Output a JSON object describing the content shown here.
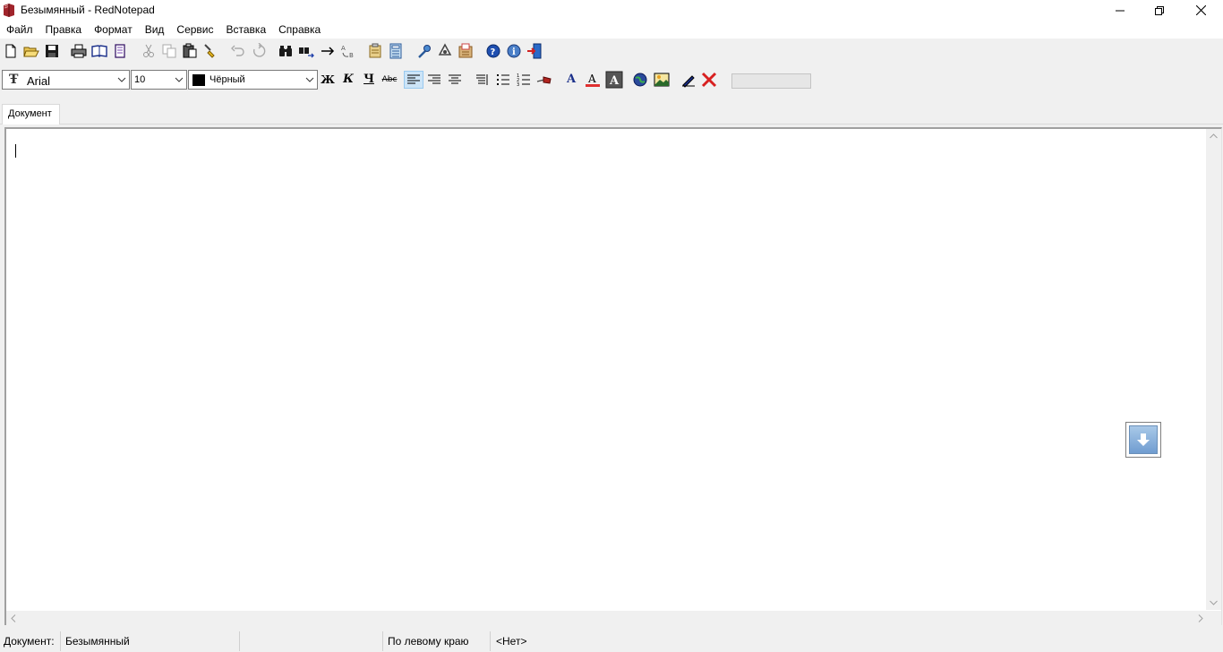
{
  "window": {
    "title": "Безымянный - RedNotepad"
  },
  "menu": [
    "Файл",
    "Правка",
    "Формат",
    "Вид",
    "Сервис",
    "Вставка",
    "Справка"
  ],
  "format_bar": {
    "font": "Arial",
    "font_icon_glyph": "Ŧ",
    "size": "10",
    "color_name": "Чёрный",
    "color_swatch": "#000000",
    "bold_label": "Ж",
    "italic_label": "К",
    "underline_label": "Ч",
    "strike_label": "Abc"
  },
  "tabs": [
    {
      "label": "Документ",
      "active": true
    }
  ],
  "statusbar": {
    "doc_label": "Документ:",
    "doc_name": "Безымянный",
    "alignment": "По левому краю",
    "extra": "<Нет>"
  },
  "colors": {
    "accent": "#1f6fbf",
    "app_icon": "#a0242b",
    "active_align": "#cce4f7"
  }
}
